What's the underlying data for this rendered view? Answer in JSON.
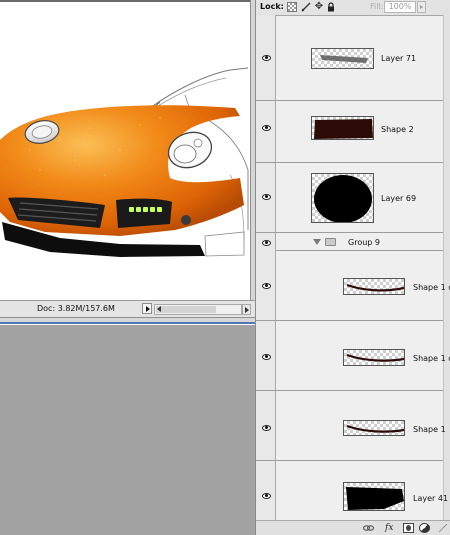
{
  "status_bar": {
    "doc_size": "Doc: 3.82M/157.6M"
  },
  "layers_panel": {
    "lock_label": "Lock:",
    "fill_label": "Fill:",
    "fill_value": "100%",
    "group_name": "Group 9"
  },
  "layers": [
    {
      "name": "Layer 71",
      "visible": true
    },
    {
      "name": "Shape 2",
      "visible": true
    },
    {
      "name": "Layer 69",
      "visible": true
    },
    {
      "name": "Shape 1 c",
      "visible": true
    },
    {
      "name": "Shape 1 c",
      "visible": true
    },
    {
      "name": "Shape 1",
      "visible": true
    },
    {
      "name": "Layer 41",
      "visible": true
    }
  ],
  "colors": {
    "canvas": "#ffffff",
    "workspace": "#a3a3a3",
    "panel": "#efefef",
    "car_orange": "#f07d0f",
    "led_green": "#c8ff5a"
  }
}
